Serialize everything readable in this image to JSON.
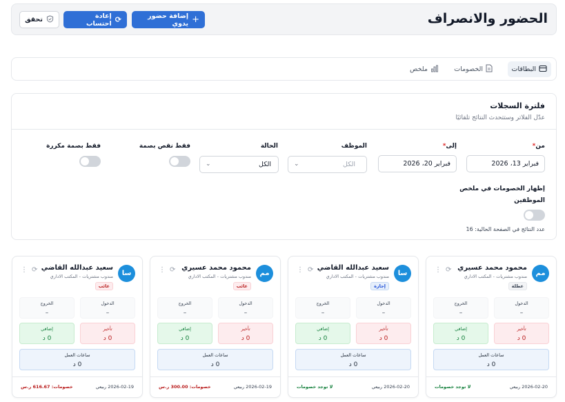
{
  "header": {
    "title": "الحضور والانصراف",
    "add_manual_label": "إضافة حضور يدوي",
    "recalc_label": "إعادة احتساب",
    "verify_label": "تحقق"
  },
  "tabs": [
    {
      "label": "البطاقات",
      "icon": "cards-icon"
    },
    {
      "label": "الخصومات",
      "icon": "document-icon"
    },
    {
      "label": "ملخص",
      "icon": "bar-chart-icon"
    }
  ],
  "filter": {
    "title": "فلترة السجلات",
    "subtitle": "عدّل الفلاتر وستتحدث النتائج تلقائيًا",
    "from_label": "من",
    "from_value": "فبراير 13، 2026",
    "to_label": "إلى",
    "to_value": "فبراير 20، 2026",
    "employee_label": "الموظف",
    "employee_placeholder": "الكل",
    "status_label": "الحالة",
    "status_value": "الكل",
    "missing_fp_label": "فقط نقص بصمة",
    "dup_fp_label": "فقط بصمة مكررة",
    "show_deductions_label_1": "إظهار الخصومات في ملخص",
    "show_deductions_label_2": "الموظفين",
    "results_count": "عدد النتائج في الصفحة الحالية: 16"
  },
  "card_labels": {
    "checkin": "الدخول",
    "checkout": "الخروج",
    "late": "تأخير",
    "extra": "إضافي",
    "work_hours": "ساعات العمل"
  },
  "cards": [
    {
      "initials": "مم",
      "name": "محمود محمد عسيري",
      "role": "مندوب مشتريات - المكتب الاداري",
      "badge": "عطلة",
      "badge_type": "gray",
      "checkin": "–",
      "checkout": "–",
      "late": "0 د",
      "extra": "0 د",
      "work_hours": "0 د",
      "date": "2026-02-20 ربيعي",
      "status": "لا توجد خصومات",
      "status_type": "green"
    },
    {
      "initials": "سا",
      "name": "سعيد عبدالله القاضي",
      "role": "مندوب مشتريات - المكتب الاداري",
      "badge": "إجازة",
      "badge_type": "blue",
      "checkin": "–",
      "checkout": "–",
      "late": "0 د",
      "extra": "0 د",
      "work_hours": "0 د",
      "date": "2026-02-20 ربيعي",
      "status": "لا توجد خصومات",
      "status_type": "green"
    },
    {
      "initials": "مم",
      "name": "محمود محمد عسيري",
      "role": "مندوب مشتريات - المكتب الاداري",
      "badge": "غائب",
      "badge_type": "red",
      "checkin": "–",
      "checkout": "–",
      "late": "0 د",
      "extra": "0 د",
      "work_hours": "0 د",
      "date": "2026-02-19 ربيعي",
      "status": "خصومات: 300.00 ر.س",
      "status_type": "red"
    },
    {
      "initials": "سا",
      "name": "سعيد عبدالله القاضي",
      "role": "مندوب مشتريات - المكتب الاداري",
      "badge": "غائب",
      "badge_type": "red",
      "checkin": "–",
      "checkout": "–",
      "late": "0 د",
      "extra": "0 د",
      "work_hours": "0 د",
      "date": "2026-02-19 ربيعي",
      "status": "خصومات: 616.67 ر.س",
      "status_type": "red"
    }
  ],
  "colors": {
    "primary": "#2f6fd6",
    "avatar": "#1d8fdc",
    "danger": "#b91c1c",
    "success": "#15803d"
  }
}
